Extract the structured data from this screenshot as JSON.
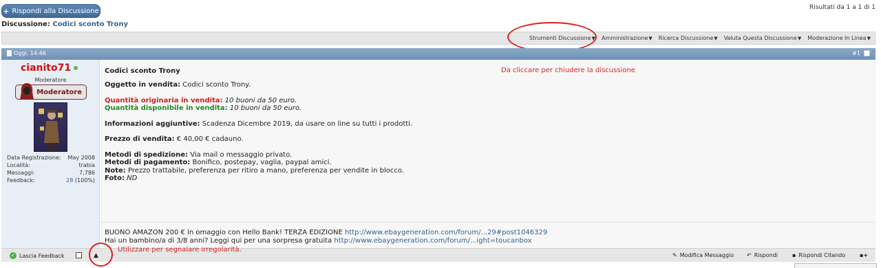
{
  "top": {
    "reply_button": "Rispondi alla Discussione",
    "results": "Risultati da 1 a 1 di 1",
    "thread_prefix": "Discussione:",
    "thread_name": "Codici sconto Trony"
  },
  "toolbar": {
    "items": [
      "Strumenti Discussione",
      "Amministrazione",
      "Ricerca Discussione",
      "Valuta Questa Discussione",
      "Moderazione In Linea"
    ]
  },
  "post": {
    "date": "Oggi, 14:46",
    "number": "#1",
    "user": {
      "name": "cianito71",
      "title": "Moderatore",
      "badge": "Moderatore",
      "info": [
        {
          "label": "Data Registrazione:",
          "value": "May 2008"
        },
        {
          "label": "Località:",
          "value": "trabia"
        },
        {
          "label": "Messaggi:",
          "value": "7,786"
        },
        {
          "label": "Feedback:",
          "link": "28",
          "value": " (100%)"
        }
      ]
    },
    "title": "Codici sconto Trony",
    "annotation": "Da cliccare per chiudere la discussione",
    "oggetto_label": "Oggetto in vendita:",
    "oggetto_value": " Codici sconto Trony.",
    "qty_orig_label": "Quantità originaria in vendita:",
    "qty_orig_value": " 10 buoni da 50 euro.",
    "qty_disp_label": "Quantità disponibile in vendita:",
    "qty_disp_value": " 10 buoni da 50 euro.",
    "info_label": "Informazioni aggiuntive:",
    "info_value": " Scadenza Dicembre 2019, da usare on line su tutti i prodotti.",
    "prezzo_label": "Prezzo di vendita:",
    "prezzo_value": " € 40,00 € cadauno.",
    "sped_label": "Metodi di spedizione:",
    "sped_value": " Via mail o messaggio privato.",
    "pag_label": "Metodi di pagamento:",
    "pag_value": " Bonifico, postepay, vaglia, paypal amici.",
    "note_label": "Note:",
    "note_value": " Prezzo trattabile, preferenza per ritiro a mano, preferenza per vendite in blocco.",
    "foto_label": "Foto:",
    "foto_value": " ND",
    "sig1_text": "BUONO AMAZON 200 € in omaggio con Hello Bank! TERZA EDIZIONE ",
    "sig1_link": "http://www.ebaygeneration.com/forum/...29#post1046329",
    "sig2_text": "Hai un bambino/a di 3/8 anni? Leggi qui per una sorpresa gratuita ",
    "sig2_link": "http://www.ebaygeneration.com/forum/...ight=toucanbox"
  },
  "footer": {
    "feedback": "Lascia Feedback",
    "report_annotation": "Utilizzare per segnalare irregolarità.",
    "edit": "Modifica Messaggio",
    "reply": "Rispondi",
    "quote": "Rispondi Citando"
  },
  "colors": {
    "accent": "#36628f",
    "annotation": "#e01e1e",
    "username": "#cc1010"
  }
}
